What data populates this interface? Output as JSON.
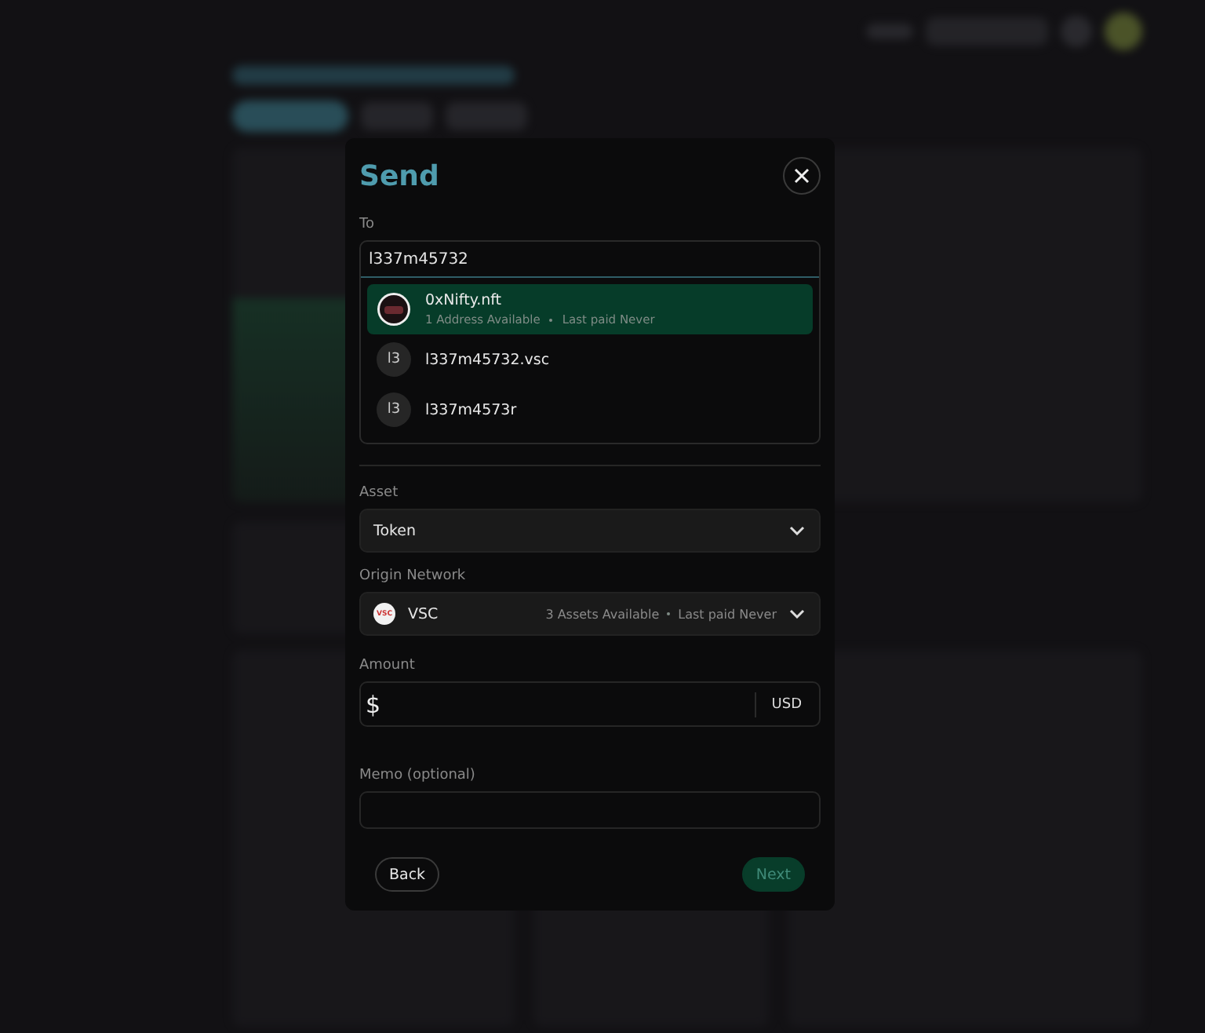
{
  "dialog": {
    "title": "Send",
    "to": {
      "label": "To",
      "value": "l337m45732",
      "suggestions": [
        {
          "name": "0xNifty.nft",
          "kind": "image",
          "details": [
            "1 Address Available",
            "Last paid Never"
          ],
          "selected": true
        },
        {
          "name": "l337m45732.vsc",
          "kind": "initials",
          "initials": "l3",
          "selected": false
        },
        {
          "name": "l337m4573r",
          "kind": "initials",
          "initials": "l3",
          "selected": false
        }
      ]
    },
    "asset": {
      "label": "Asset",
      "value": "Token"
    },
    "network": {
      "label": "Origin Network",
      "logo_text": "VSC",
      "value": "VSC",
      "details": [
        "3 Assets Available",
        "Last paid Never"
      ]
    },
    "amount": {
      "label": "Amount",
      "symbol": "$",
      "unit": "USD"
    },
    "memo": {
      "label": "Memo (optional)"
    },
    "buttons": [
      {
        "label": "Back",
        "kind": "secondary",
        "disabled": false
      },
      {
        "label": "Next",
        "kind": "primary",
        "disabled": true
      }
    ]
  }
}
